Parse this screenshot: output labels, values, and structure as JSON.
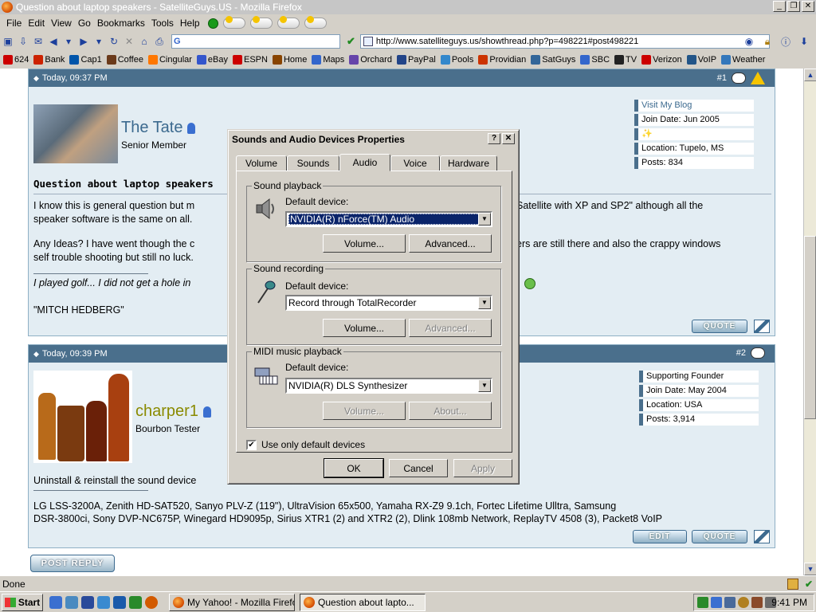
{
  "window": {
    "title": "Question about laptop speakers - SatelliteGuys.US - Mozilla Firefox"
  },
  "menu": [
    "File",
    "Edit",
    "View",
    "Go",
    "Bookmarks",
    "Tools",
    "Help"
  ],
  "nav": {
    "search_prefix": "G",
    "url": "http://www.satelliteguys.us/showthread.php?p=498221#post498221"
  },
  "bookmarks": [
    {
      "label": "624",
      "color": "#cc0000"
    },
    {
      "label": "Bank",
      "color": "#cc2200"
    },
    {
      "label": "Cap1",
      "color": "#0055aa"
    },
    {
      "label": "Coffee",
      "color": "#6b3a1a"
    },
    {
      "label": "Cingular",
      "color": "#ff7700"
    },
    {
      "label": "eBay",
      "color": "#3355cc"
    },
    {
      "label": "ESPN",
      "color": "#cc0000"
    },
    {
      "label": "Home",
      "color": "#884400"
    },
    {
      "label": "Maps",
      "color": "#3366cc"
    },
    {
      "label": "Orchard",
      "color": "#6644aa"
    },
    {
      "label": "PayPal",
      "color": "#224488"
    },
    {
      "label": "Pools",
      "color": "#3388cc"
    },
    {
      "label": "Providian",
      "color": "#cc3300"
    },
    {
      "label": "SatGuys",
      "color": "#336699"
    },
    {
      "label": "SBC",
      "color": "#3366cc"
    },
    {
      "label": "TV",
      "color": "#222222"
    },
    {
      "label": "Verizon",
      "color": "#cc0000"
    },
    {
      "label": "VoIP",
      "color": "#225588"
    },
    {
      "label": "Weather",
      "color": "#3377bb"
    }
  ],
  "post1": {
    "timestamp": "Today, 09:37 PM",
    "number": "#1",
    "username": "The Tate",
    "user_title": "Senior Member",
    "info": [
      "Visit My Blog",
      "Join Date: Jun 2005",
      "",
      "Location: Tupelo, MS",
      "Posts: 834"
    ],
    "subject": "Question about laptop speakers",
    "line1a": "I know this is general question but m",
    "line1b": "Satellite with XP and SP2\" although all the",
    "line2": "speaker software is the same on all.",
    "line3a": "Any Ideas? I have went though the c",
    "line3b": "ers are still there and also the crappy windows",
    "line4": "self trouble shooting but still no luck.",
    "sig1": "I played golf... I did not get a hole in",
    "sig2": "\"MITCH HEDBERG\"",
    "quote_label": "QUOTE"
  },
  "post2": {
    "timestamp": "Today, 09:39 PM",
    "number": "#2",
    "username": "charper1",
    "user_title": "Bourbon Tester",
    "info": [
      "Supporting Founder",
      "Join Date: May 2004",
      "Location: USA",
      "Posts: 3,914"
    ],
    "body": "Uninstall & reinstall the sound device",
    "sig1": "LG LSS-3200A, Zenith HD-SAT520, Sanyo PLV-Z (119\"), UltraVision 65x500, Yamaha RX-Z9 9.1ch, Fortec Lifetime Ulltra, Samsung",
    "sig2": "DSR-3800ci, Sony DVP-NC675P, Winegard HD9095p, Sirius XTR1 (2) and XTR2 (2), Dlink 108mb Network, ReplayTV 4508 (3), Packet8 VoIP",
    "edit_label": "EDIT",
    "quote_label": "QUOTE"
  },
  "post_reply_label": "POST REPLY",
  "status": "Done",
  "taskbar": {
    "start": "Start",
    "tasks": [
      "My Yahoo! - Mozilla Firefox",
      "Question about lapto..."
    ],
    "clock": "9:41 PM"
  },
  "dialog": {
    "title": "Sounds and Audio Devices Properties",
    "tabs": [
      "Volume",
      "Sounds",
      "Audio",
      "Voice",
      "Hardware"
    ],
    "playback": {
      "legend": "Sound playback",
      "label": "Default device:",
      "device": "NVIDIA(R) nForce(TM) Audio",
      "volume": "Volume...",
      "advanced": "Advanced..."
    },
    "recording": {
      "legend": "Sound recording",
      "label": "Default device:",
      "device": "Record through TotalRecorder",
      "volume": "Volume...",
      "advanced": "Advanced..."
    },
    "midi": {
      "legend": "MIDI music playback",
      "label": "Default device:",
      "device": "NVIDIA(R) DLS Synthesizer",
      "volume": "Volume...",
      "about": "About..."
    },
    "checkbox": "Use only default devices",
    "ok": "OK",
    "cancel": "Cancel",
    "apply": "Apply"
  }
}
